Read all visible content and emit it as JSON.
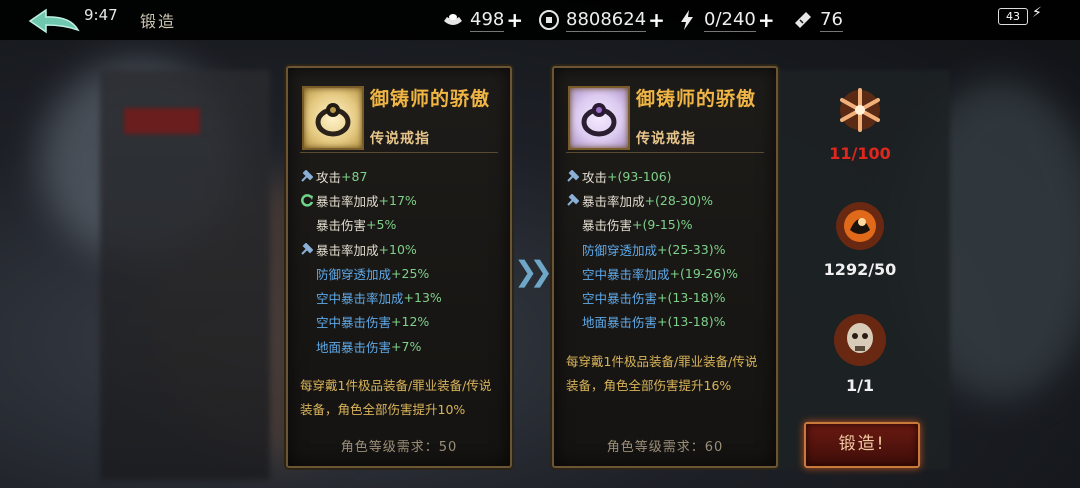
{
  "header": {
    "time": "9:47",
    "title": "锻造",
    "resources": [
      {
        "icon": "ingot-icon",
        "value": "498"
      },
      {
        "icon": "coin-icon",
        "value": "8808624"
      },
      {
        "icon": "energy-bolt-icon",
        "value": "0/240"
      },
      {
        "icon": "ticket-icon",
        "value": "76"
      }
    ],
    "battery": "43"
  },
  "left_card": {
    "name": "御铸师的骄傲",
    "type": "传说戒指",
    "stats": [
      {
        "icon": "hammer-icon",
        "name": "攻击",
        "value": "+87",
        "style": "base"
      },
      {
        "icon": "reroll-icon",
        "name": "暴击率加成",
        "value": "+17%",
        "style": "base"
      },
      {
        "icon": "",
        "name": "暴击伤害",
        "value": "+5%",
        "style": "base"
      },
      {
        "icon": "hammer-icon",
        "name": "暴击率加成",
        "value": "+10%",
        "style": "base"
      },
      {
        "icon": "",
        "name": "防御穿透加成",
        "value": "+25%",
        "style": "blue"
      },
      {
        "icon": "",
        "name": "空中暴击率加成",
        "value": "+13%",
        "style": "blue"
      },
      {
        "icon": "",
        "name": "空中暴击伤害",
        "value": "+12%",
        "style": "blue"
      },
      {
        "icon": "",
        "name": "地面暴击伤害",
        "value": "+7%",
        "style": "blue"
      }
    ],
    "bonus": "每穿戴1件极品装备/罪业装备/传说装备，角色全部伤害提升10%",
    "requirement": "角色等级需求：50"
  },
  "right_card": {
    "name": "御铸师的骄傲",
    "type": "传说戒指",
    "stats": [
      {
        "icon": "hammer-icon",
        "name": "攻击",
        "value": "+(93-106)",
        "style": "base"
      },
      {
        "icon": "hammer-icon",
        "name": "暴击率加成",
        "value": "+(28-30)%",
        "style": "base"
      },
      {
        "icon": "",
        "name": "暴击伤害",
        "value": "+(9-15)%",
        "style": "base"
      },
      {
        "icon": "",
        "name": "防御穿透加成",
        "value": "+(25-33)%",
        "style": "blue"
      },
      {
        "icon": "",
        "name": "空中暴击率加成",
        "value": "+(19-26)%",
        "style": "blue"
      },
      {
        "icon": "",
        "name": "空中暴击伤害",
        "value": "+(13-18)%",
        "style": "blue"
      },
      {
        "icon": "",
        "name": "地面暴击伤害",
        "value": "+(13-18)%",
        "style": "blue"
      }
    ],
    "bonus": "每穿戴1件极品装备/罪业装备/传说装备，角色全部伤害提升16%",
    "requirement": "角色等级需求：60"
  },
  "materials": [
    {
      "icon": "snowflake-emblem-icon",
      "count": "11/100",
      "color": "#e0271e"
    },
    {
      "icon": "fire-ore-icon",
      "count": "1292/50",
      "color": "#f0f0f0"
    },
    {
      "icon": "skull-relic-icon",
      "count": "1/1",
      "color": "#f0f0f0"
    }
  ],
  "forge_button": "锻造!",
  "colors": {
    "gold": "#f0b544",
    "blue_stat": "#5fa9e8",
    "green_value": "#7fd08a"
  }
}
